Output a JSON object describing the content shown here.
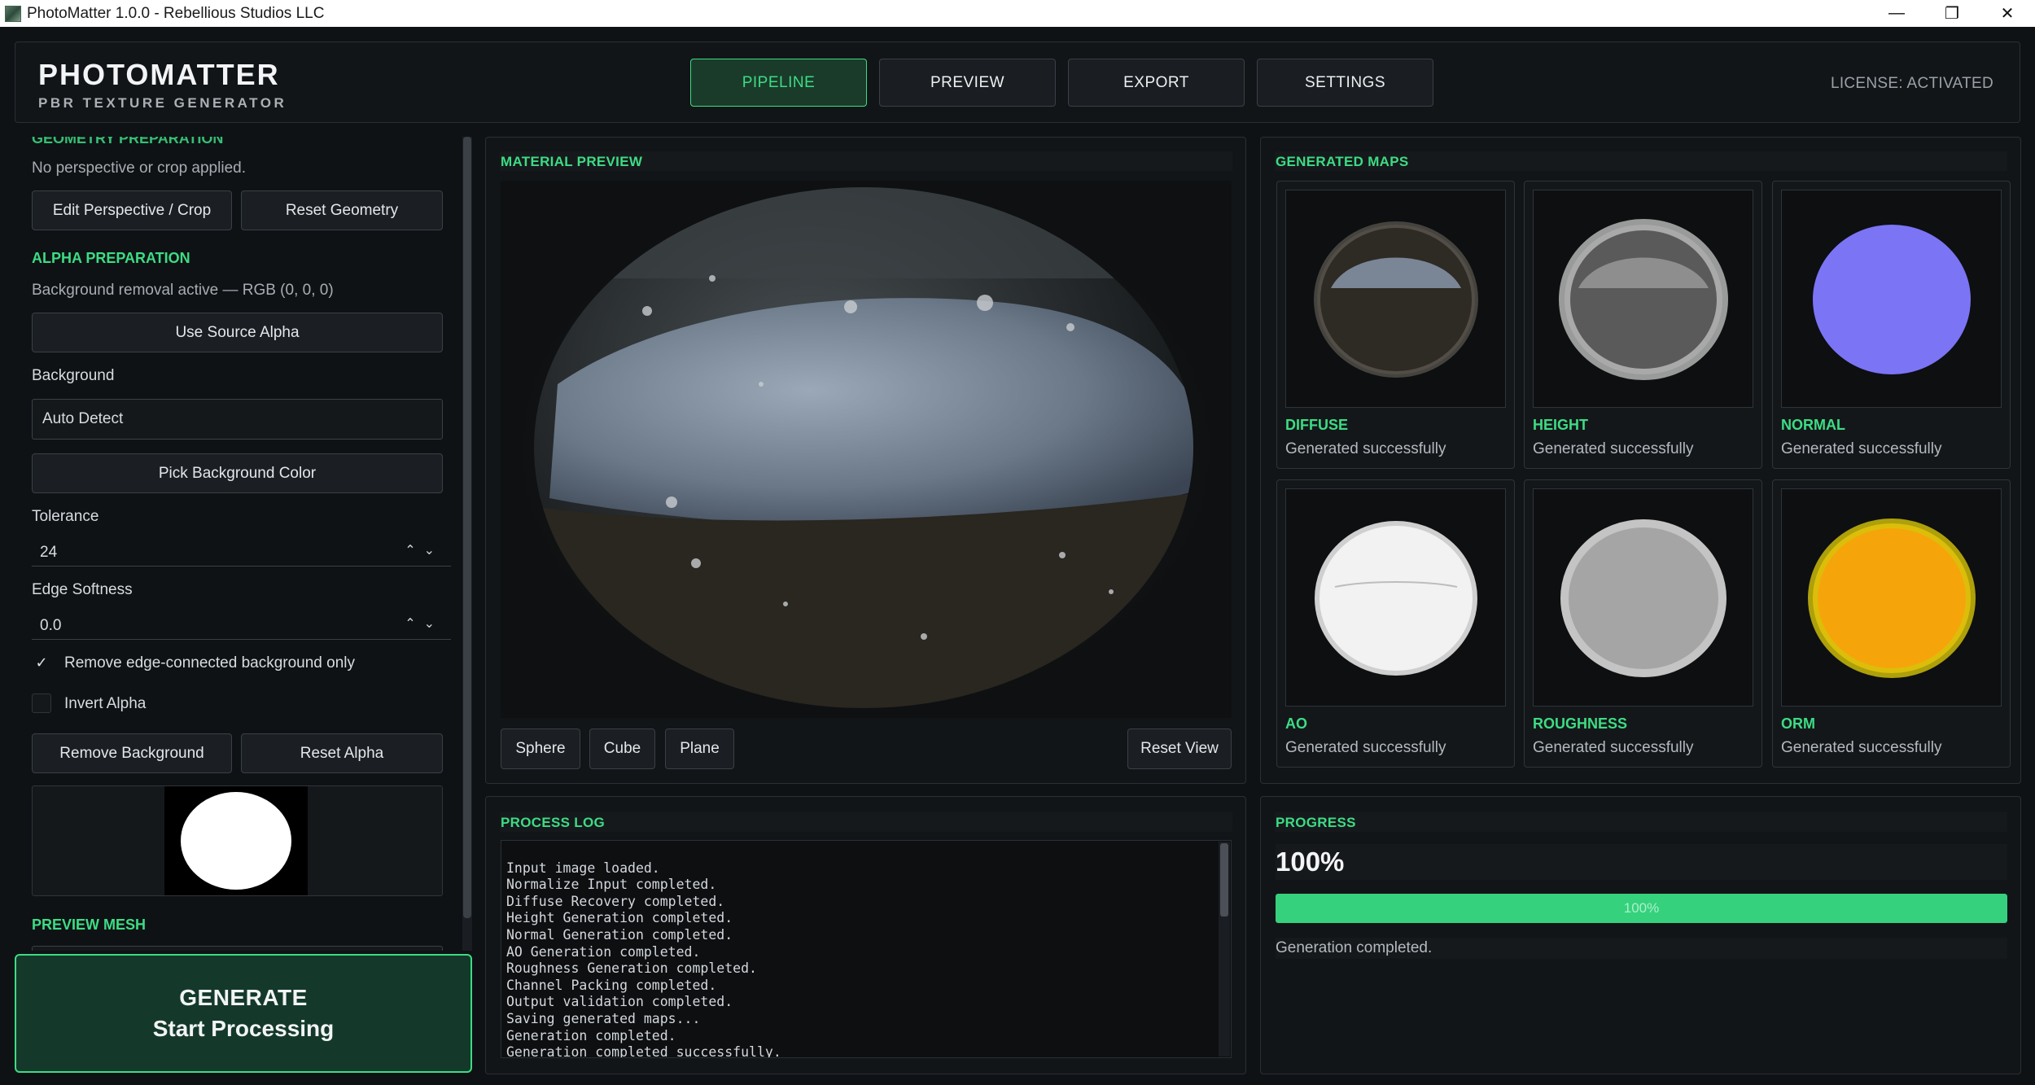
{
  "window": {
    "title": "PhotoMatter 1.0.0 - Rebellious Studios LLC"
  },
  "header": {
    "brand": "PHOTOMATTER",
    "tagline": "PBR TEXTURE GENERATOR",
    "tabs": [
      {
        "label": "PIPELINE",
        "active": true
      },
      {
        "label": "PREVIEW",
        "active": false
      },
      {
        "label": "EXPORT",
        "active": false
      },
      {
        "label": "SETTINGS",
        "active": false
      }
    ],
    "license": "LICENSE: ACTIVATED"
  },
  "sidebar": {
    "geometry": {
      "title": "GEOMETRY PREPARATION",
      "status": "No perspective or crop applied.",
      "edit_label": "Edit Perspective / Crop",
      "reset_label": "Reset Geometry"
    },
    "alpha": {
      "title": "ALPHA PREPARATION",
      "status": "Background removal active — RGB (0, 0, 0)",
      "use_source_label": "Use Source Alpha",
      "background_label": "Background",
      "background_value": "Auto Detect",
      "pick_color_label": "Pick Background Color",
      "tolerance_label": "Tolerance",
      "tolerance_value": "24",
      "edge_softness_label": "Edge Softness",
      "edge_softness_value": "0.0",
      "edge_only_label": "Remove edge-connected background only",
      "edge_only_checked": true,
      "invert_label": "Invert Alpha",
      "invert_checked": false,
      "remove_bg_label": "Remove Background",
      "reset_alpha_label": "Reset Alpha"
    },
    "preview_mesh": {
      "title": "PREVIEW MESH"
    }
  },
  "generate": {
    "line1": "GENERATE",
    "line2": "Start Processing"
  },
  "material_preview": {
    "title": "MATERIAL PREVIEW",
    "shapes": [
      "Sphere",
      "Cube",
      "Plane"
    ],
    "reset_label": "Reset View"
  },
  "maps": {
    "title": "GENERATED MAPS",
    "items": [
      {
        "name": "DIFFUSE",
        "status": "Generated successfully"
      },
      {
        "name": "HEIGHT",
        "status": "Generated successfully"
      },
      {
        "name": "NORMAL",
        "status": "Generated successfully",
        "color": "#7b74f5"
      },
      {
        "name": "AO",
        "status": "Generated successfully"
      },
      {
        "name": "ROUGHNESS",
        "status": "Generated successfully"
      },
      {
        "name": "ORM",
        "status": "Generated successfully",
        "color": "#f5a50a"
      }
    ]
  },
  "log": {
    "title": "PROCESS LOG",
    "lines": [
      "Input image loaded.",
      "Normalize Input completed.",
      "Diffuse Recovery completed.",
      "Height Generation completed.",
      "Normal Generation completed.",
      "AO Generation completed.",
      "Roughness Generation completed.",
      "Channel Packing completed.",
      "Output validation completed.",
      "Saving generated maps...",
      "Generation completed.",
      "Generation completed successfully."
    ]
  },
  "progress": {
    "title": "PROGRESS",
    "value_text": "100%",
    "fraction": 1.0,
    "bar_text": "100%",
    "status": "Generation completed."
  },
  "colors": {
    "accent": "#3ddc84",
    "background": "#0f1215",
    "panel": "#121518"
  }
}
